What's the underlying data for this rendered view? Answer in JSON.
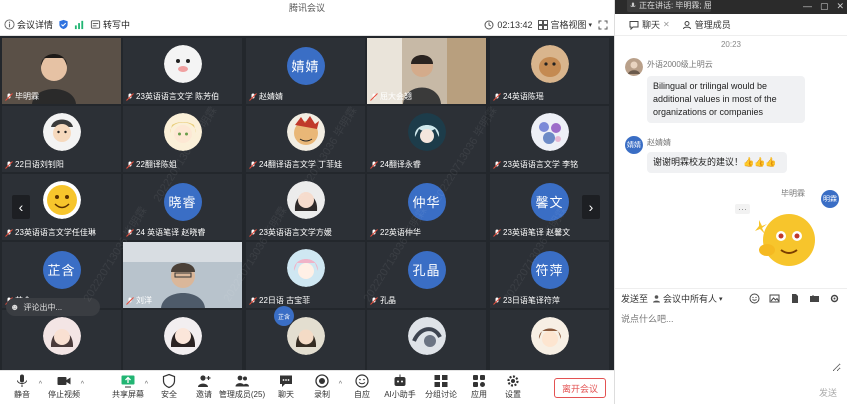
{
  "app": {
    "title": "腾讯会议"
  },
  "infobar": {
    "meeting_info_label": "会议详情",
    "recording_label": "转写中",
    "timer": "02:13:42",
    "view_label": "宫格视图"
  },
  "grid": {
    "tiles": [
      {
        "name": "毕明霖",
        "type": "video",
        "active": true
      },
      {
        "name": "23英语语言文学 陈芳伯",
        "type": "photo",
        "avatar": "white-animal"
      },
      {
        "name": "赵婧婧",
        "type": "circle",
        "initials": "婧婧"
      },
      {
        "name": "屈大会翘",
        "type": "video"
      },
      {
        "name": "24英语陈瑶",
        "type": "photo",
        "avatar": "dog"
      },
      {
        "name": "22日语刘钊阳",
        "type": "photo",
        "avatar": "cartoon-boy"
      },
      {
        "name": "22翻译陈姐",
        "type": "photo",
        "avatar": "anime-blonde"
      },
      {
        "name": "24翻译语言文学 丁菲娃",
        "type": "photo",
        "avatar": "red-face"
      },
      {
        "name": "24翻译永睿",
        "type": "photo",
        "avatar": "anime-teal"
      },
      {
        "name": "23英语语言文学 李铭",
        "type": "photo",
        "avatar": "flowers"
      },
      {
        "name": "23英语语言文学任佳琳",
        "type": "photo",
        "avatar": "emoji"
      },
      {
        "name": "24 英语笔译 赵晓睿",
        "type": "circle",
        "initials": "晓睿"
      },
      {
        "name": "23英语语言文学方媛",
        "type": "photo",
        "avatar": "girl"
      },
      {
        "name": "22英语仲华",
        "type": "circle",
        "initials": "仲华"
      },
      {
        "name": "23英语笔译 赵馨文",
        "type": "circle",
        "initials": "馨文"
      },
      {
        "name": "芷含",
        "type": "circle",
        "initials": "芷含"
      },
      {
        "name": "刘洋",
        "type": "video"
      },
      {
        "name": "22日语 古宝菲",
        "type": "photo",
        "avatar": "anime-pink"
      },
      {
        "name": "孔晶",
        "type": "circle",
        "initials": "孔晶"
      },
      {
        "name": "23日语笔译符萍",
        "type": "circle",
        "initials": "符萍"
      },
      {
        "name": "",
        "type": "photo",
        "avatar": "girl2"
      },
      {
        "name": "",
        "type": "photo",
        "avatar": "girl3"
      },
      {
        "name": "",
        "type": "photo",
        "avatar": "girl4"
      },
      {
        "name": "",
        "type": "photo",
        "avatar": "ink"
      },
      {
        "name": "",
        "type": "photo",
        "avatar": "cartoon-girl"
      }
    ],
    "floating_note": "评论出中...",
    "mini_badge": "芷含",
    "watermark": "202220713036 毕明霖"
  },
  "toolbar": {
    "items": [
      {
        "label": "静音",
        "icon": "mic-icon"
      },
      {
        "label": "停止视频",
        "icon": "camera-icon"
      },
      {
        "label": "共享屏幕",
        "icon": "share-screen-icon"
      },
      {
        "label": "安全",
        "icon": "shield-icon"
      },
      {
        "label": "邀请",
        "icon": "invite-icon"
      },
      {
        "label": "管理成员(25)",
        "icon": "members-icon"
      },
      {
        "label": "聊天",
        "icon": "chat-icon"
      },
      {
        "label": "录制",
        "icon": "record-icon"
      },
      {
        "label": "自应",
        "icon": "reaction-icon"
      },
      {
        "label": "AI小助手",
        "icon": "ai-assistant-icon"
      },
      {
        "label": "分组讨论",
        "icon": "breakout-icon"
      },
      {
        "label": "应用",
        "icon": "apps-icon"
      },
      {
        "label": "设置",
        "icon": "settings-icon"
      }
    ],
    "leave_label": "离开会议"
  },
  "panel": {
    "popup_text": "正在讲话: 毕明霖; 屈大会翘",
    "tabs": [
      {
        "label": "聊天"
      },
      {
        "label": "管理成员"
      }
    ],
    "time": "20:23",
    "messages": [
      {
        "sender": "外语2000级上明云",
        "text": "Bilingual or trilingal would be additional values in most of the organizations or companies"
      },
      {
        "sender": "赵婧婧",
        "avatar_initials": "婧婧",
        "text": "谢谢明霖校友的建议！👍👍👍"
      },
      {
        "sender": "毕明霖",
        "avatar_initials": "明霖"
      }
    ],
    "send_to_label": "发送至",
    "send_to_target": "会议中所有人",
    "input_placeholder": "说点什么吧...",
    "send_label": "发送"
  },
  "colors": {
    "accent": "#3a6ec5",
    "grid_bg": "#23272c",
    "leave": "#e35252",
    "active": "#22b573"
  }
}
